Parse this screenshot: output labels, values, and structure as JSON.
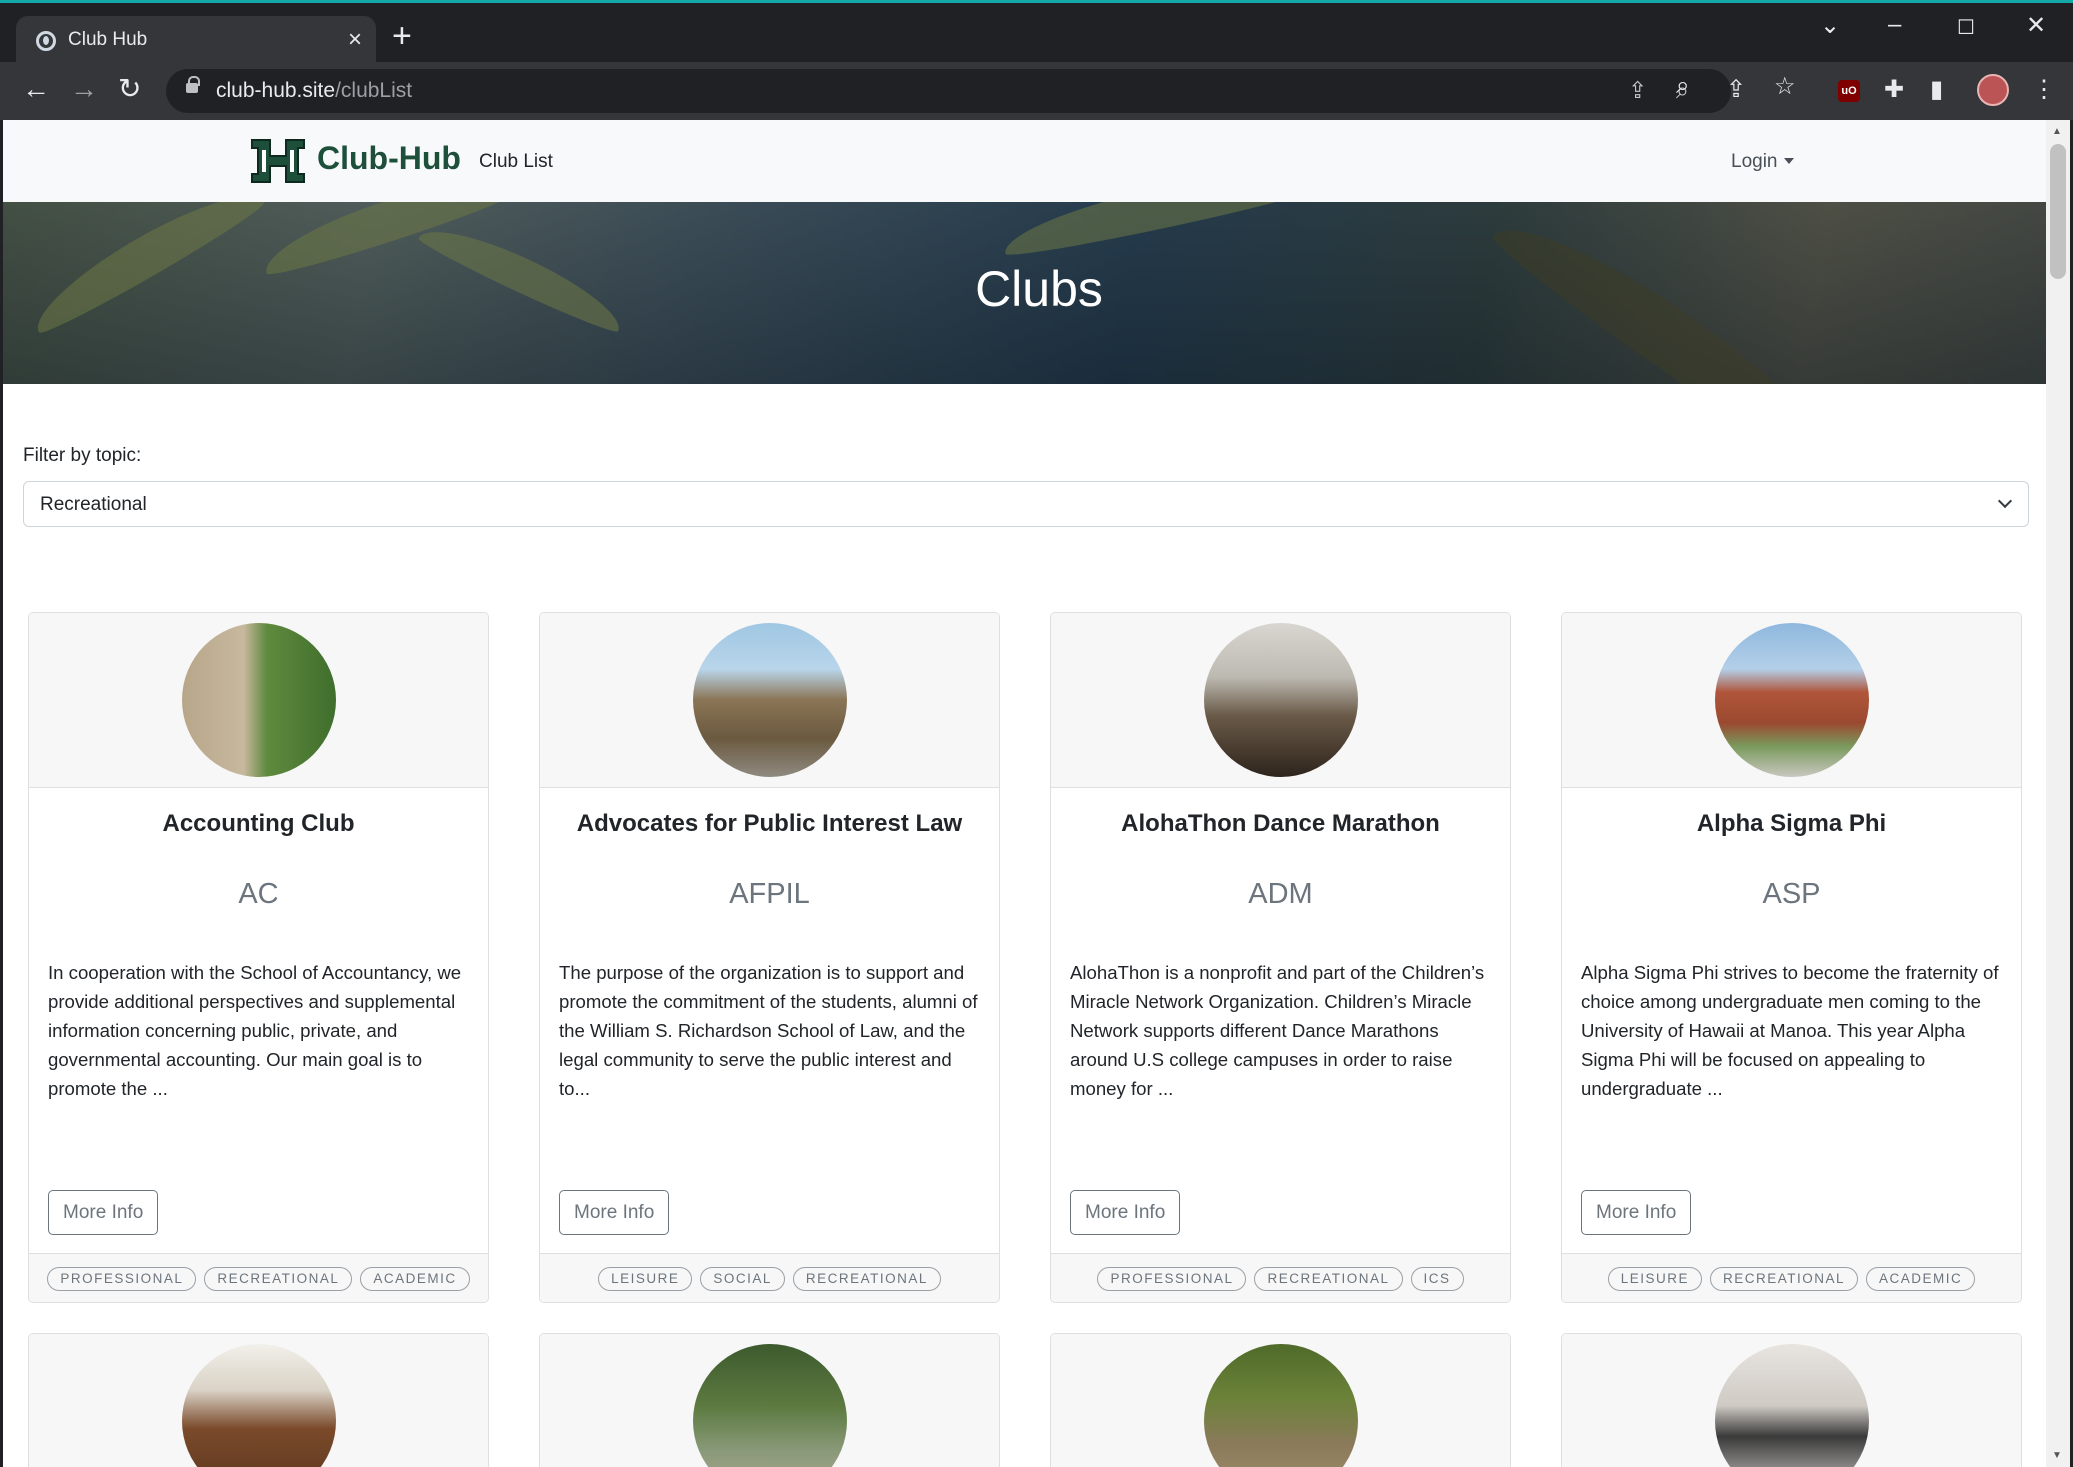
{
  "browser": {
    "tab_title": "Club Hub",
    "tab_close": "×",
    "new_tab": "+",
    "url_host": "club-hub.site",
    "url_path": "/clubList",
    "icons": [
      "back-icon",
      "forward-icon",
      "reload-icon",
      "zoom-icon",
      "share-icon",
      "star-icon",
      "extensions-icon",
      "side-panel-icon",
      "menu-icon"
    ]
  },
  "navbar": {
    "brand": "Club-Hub",
    "club_list_link": "Club List",
    "login": "Login"
  },
  "hero": {
    "title": "Clubs"
  },
  "filter": {
    "label": "Filter by topic:",
    "selected": "Recreational"
  },
  "cards": [
    {
      "name": "Accounting Club",
      "abbr": "AC",
      "description": "In cooperation with the School of Accountancy, we provide additional perspectives and supplemental information concerning public, private, and governmental accounting. Our main goal is to promote the ...",
      "button": "More Info",
      "tags": [
        "PROFESSIONAL",
        "RECREATIONAL",
        "ACADEMIC"
      ]
    },
    {
      "name": "Advocates for Public Interest Law",
      "abbr": "AFPIL",
      "description": "The purpose of the organization is to support and promote the commitment of the students, alumni of the William S. Richardson School of Law, and the legal community to serve the public interest and to...",
      "button": "More Info",
      "tags": [
        "LEISURE",
        "SOCIAL",
        "RECREATIONAL"
      ]
    },
    {
      "name": "AlohaThon Dance Marathon",
      "abbr": "ADM",
      "description": "AlohaThon is a nonprofit and part of the Children’s Miracle Network Organization. Children’s Miracle Network supports different Dance Marathons around U.S college campuses in order to raise money for ...",
      "button": "More Info",
      "tags": [
        "PROFESSIONAL",
        "RECREATIONAL",
        "ICS"
      ]
    },
    {
      "name": "Alpha Sigma Phi",
      "abbr": "ASP",
      "description": "Alpha Sigma Phi strives to become the fraternity of choice among undergraduate men coming to the University of Hawaii at Manoa. This year Alpha Sigma Phi will be focused on appealing to undergraduate ...",
      "button": "More Info",
      "tags": [
        "LEISURE",
        "RECREATIONAL",
        "ACADEMIC"
      ]
    }
  ],
  "colors": {
    "brand_green": "#1d4f3a",
    "navbar_bg": "#f8f9fa",
    "secondary_text": "#6c757d"
  }
}
